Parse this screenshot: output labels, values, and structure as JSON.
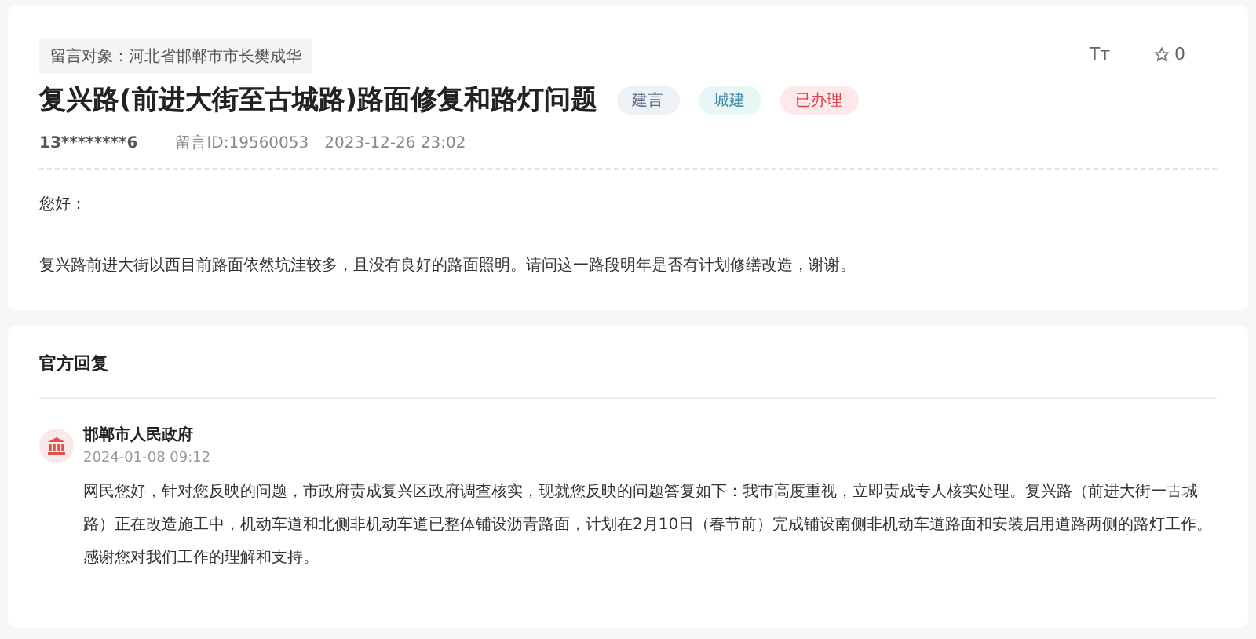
{
  "message": {
    "recipient": "留言对象：河北省邯郸市市长樊成华",
    "title": "复兴路(前进大街至古城路)路面修复和路灯问题",
    "tags": [
      {
        "label": "建言",
        "kind": "type"
      },
      {
        "label": "城建",
        "kind": "category"
      },
      {
        "label": "已办理",
        "kind": "status"
      }
    ],
    "author": "13********6",
    "message_id": "留言ID:19560053",
    "time": "2023-12-26 23:02",
    "font_size_button": "Tт",
    "likes": "0",
    "paragraphs": [
      "您好：",
      "复兴路前进大街以西目前路面依然坑洼较多，且没有良好的路面照明。请问这一路段明年是否有计划修缮改造，谢谢。"
    ]
  },
  "reply": {
    "heading": "官方回复",
    "office": "邯郸市人民政府",
    "time": "2024-01-08 09:12",
    "text": "网民您好，针对您反映的问题，市政府责成复兴区政府调查核实，现就您反映的问题答复如下：我市高度重视，立即责成专人核实处理。复兴路（前进大街一古城路）正在改造施工中，机动车道和北侧非机动车道已整体铺设沥青路面，计划在2月10日（春节前）完成铺设南侧非机动车道路面和安装启用道路两侧的路灯工作。感谢您对我们工作的理解和支持。"
  }
}
